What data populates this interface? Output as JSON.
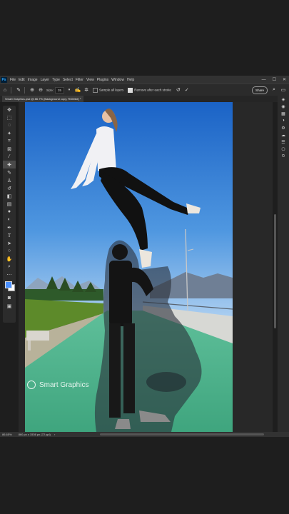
{
  "app": {
    "logo": "Ps"
  },
  "menu": [
    "File",
    "Edit",
    "Image",
    "Layer",
    "Type",
    "Select",
    "Filter",
    "View",
    "Plugins",
    "Window",
    "Help"
  ],
  "window_controls": {
    "minimize": "—",
    "maximize": "☐",
    "close": "✕"
  },
  "options_bar": {
    "size_label": "Size:",
    "size_value": "35",
    "sample_all_layers": "Sample all layers",
    "remove_after_each_stroke": "Remove after each stroke",
    "share_label": "Share"
  },
  "document_tab": {
    "title": "Smart Graphics.psd @ 86.7% (Background copy, RGB/8#) *"
  },
  "tools": [
    "move-icon",
    "marquee-icon",
    "lasso-icon",
    "quick-select-icon",
    "crop-icon",
    "frame-icon",
    "eyedropper-icon",
    "spot-heal-icon",
    "brush-icon",
    "stamp-icon",
    "history-brush-icon",
    "eraser-icon",
    "gradient-icon",
    "blur-icon",
    "dodge-icon",
    "pen-icon",
    "type-icon",
    "path-select-icon",
    "rectangle-icon",
    "hand-icon",
    "zoom-icon",
    "more-icon"
  ],
  "status": {
    "zoom": "86.65%",
    "dimensions": "860 px x 1536 px (72 ppi)"
  },
  "watermark": {
    "text": "Smart Graphics"
  },
  "colors": {
    "foreground": "#4a90ff",
    "background": "#ffffff",
    "accent": "#31a8ff"
  }
}
